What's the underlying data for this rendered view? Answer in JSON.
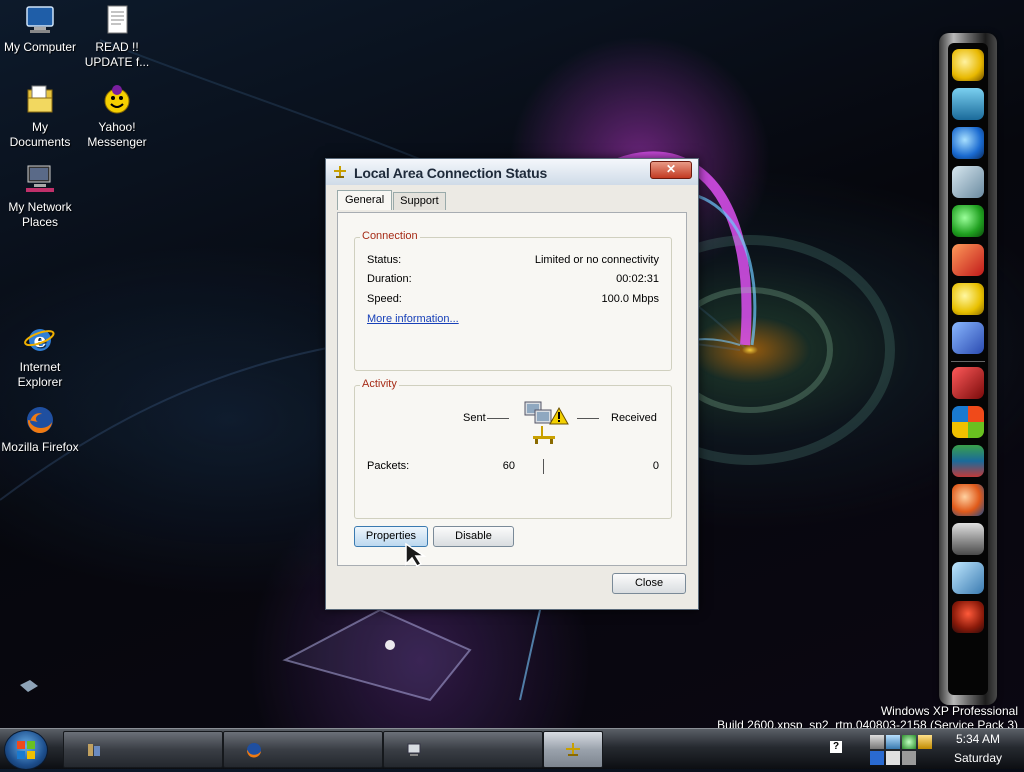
{
  "desktop": {
    "icons": [
      {
        "label": "My Computer",
        "icon": "my-computer-icon"
      },
      {
        "label": "READ !! UPDATE f...",
        "icon": "text-document-icon"
      },
      {
        "label": "My Documents",
        "icon": "my-documents-icon"
      },
      {
        "label": "Yahoo! Messenger",
        "icon": "yahoo-messenger-icon"
      },
      {
        "label": "My Network Places",
        "icon": "network-places-icon"
      },
      {
        "label": "Internet Explorer",
        "icon": "internet-explorer-icon"
      },
      {
        "label": "Mozilla Firefox",
        "icon": "firefox-icon"
      }
    ]
  },
  "dialog": {
    "title": "Local Area Connection Status",
    "close_glyph": "✕",
    "tabs": [
      {
        "label": "General",
        "active": true
      },
      {
        "label": "Support",
        "active": false
      }
    ],
    "connection": {
      "legend": "Connection",
      "status_label": "Status:",
      "status_value": "Limited or no connectivity",
      "duration_label": "Duration:",
      "duration_value": "00:02:31",
      "speed_label": "Speed:",
      "speed_value": "100.0 Mbps",
      "more_info": "More information..."
    },
    "activity": {
      "legend": "Activity",
      "sent_label": "Sent",
      "received_label": "Received",
      "packets_label": "Packets:",
      "packets_sent": "60",
      "packets_received": "0"
    },
    "buttons": {
      "properties": "Properties",
      "disable": "Disable",
      "close": "Close"
    }
  },
  "os_info": {
    "line1": "Windows XP Professional",
    "line2": "Build 2600.xpsp_sp2_rtm.040803-2158 (Service Pack 3)"
  },
  "taskbar": {
    "tray_help": "?",
    "clock_time": "5:34 AM",
    "clock_day": "Saturday"
  },
  "colors": {
    "legend_red": "#a62b16",
    "link_blue": "#1740b8",
    "close_red": "#c23a22"
  }
}
